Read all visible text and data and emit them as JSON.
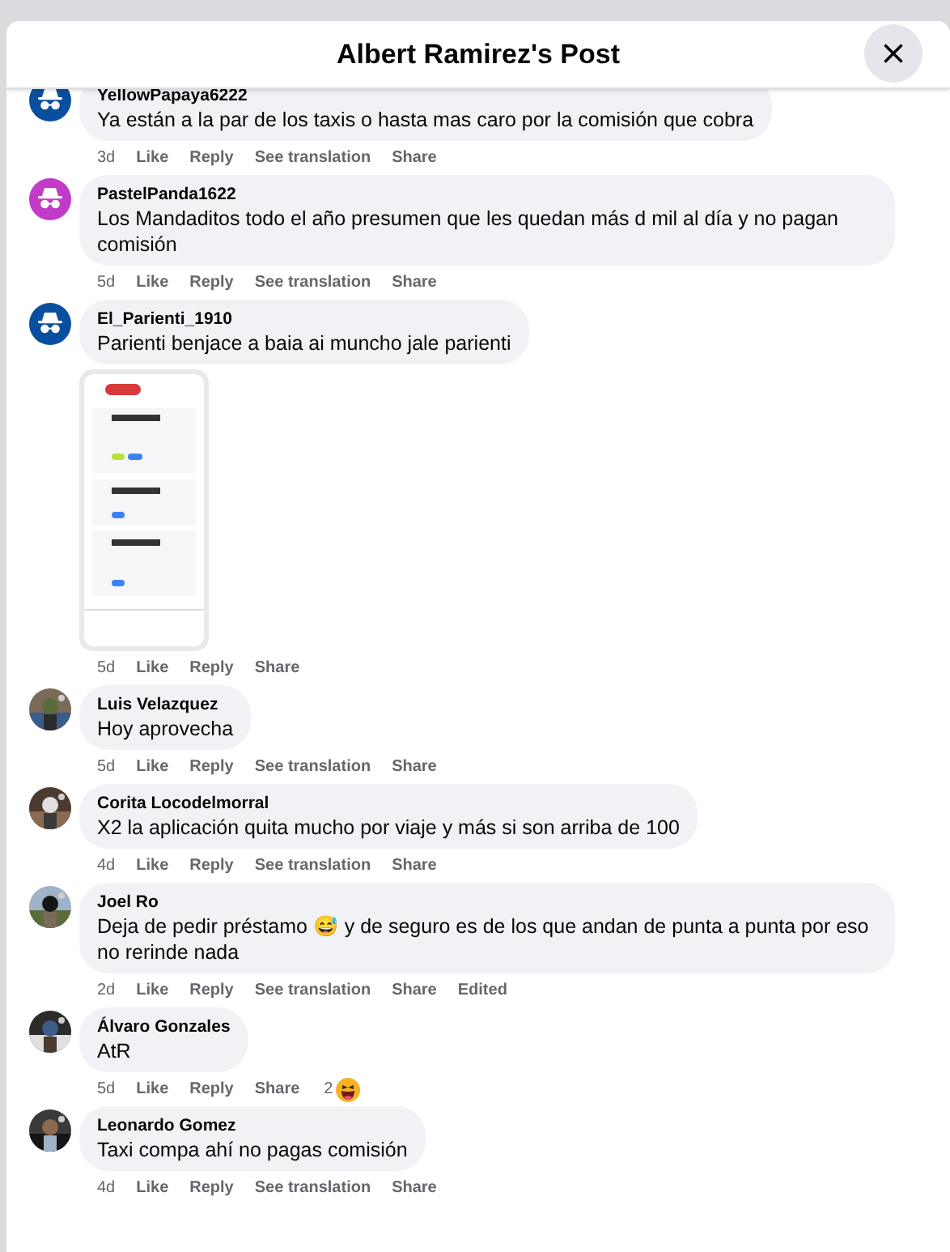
{
  "dialog": {
    "title": "Albert Ramirez's Post"
  },
  "comments": [
    {
      "author": "YellowPapaya6222",
      "text": "Ya están a la par de los taxis o hasta mas caro por la comisión que cobra",
      "avatar": {
        "kind": "anonymous",
        "color": "#0a4f9e"
      },
      "time": "3d",
      "like": "Like",
      "reply": "Reply",
      "translate": "See translation",
      "share": "Share"
    },
    {
      "author": "PastelPanda1622",
      "text": "Los Mandaditos todo el año presumen que les quedan más d mil al día y no pagan comisión",
      "avatar": {
        "kind": "anonymous",
        "color": "#c23bc8"
      },
      "time": "5d",
      "like": "Like",
      "reply": "Reply",
      "translate": "See translation",
      "share": "Share"
    },
    {
      "author": "El_Parienti_1910",
      "text": "Parienti benjace a baia ai muncho jale parienti",
      "avatar": {
        "kind": "anonymous",
        "color": "#0a4f9e"
      },
      "time": "5d",
      "like": "Like",
      "reply": "Reply",
      "share": "Share"
    },
    {
      "author": "Luis Velazquez",
      "text": "Hoy aprovecha",
      "time": "5d",
      "like": "Like",
      "reply": "Reply",
      "translate": "See translation",
      "share": "Share"
    },
    {
      "author": "Corita Locodelmorral",
      "text": "X2 la aplicación quita mucho por viaje y más si son arriba de 100",
      "time": "4d",
      "like": "Like",
      "reply": "Reply",
      "translate": "See translation",
      "share": "Share"
    },
    {
      "author": "Joel Ro",
      "text": "Deja de pedir préstamo 😅 y de seguro es de los que andan de punta a punta por eso no rerinde nada",
      "time": "2d",
      "like": "Like",
      "reply": "Reply",
      "translate": "See translation",
      "share": "Share",
      "edited": "Edited"
    },
    {
      "author": "Álvaro Gonzales",
      "text": "AtR",
      "time": "5d",
      "like": "Like",
      "reply": "Reply",
      "share": "Share",
      "reactions": "2"
    },
    {
      "author": "Leonardo Gomez",
      "text": "Taxi compa ahí no pagas comisión",
      "time": "4d",
      "like": "Like",
      "reply": "Reply",
      "translate": "See translation",
      "share": "Share"
    }
  ]
}
